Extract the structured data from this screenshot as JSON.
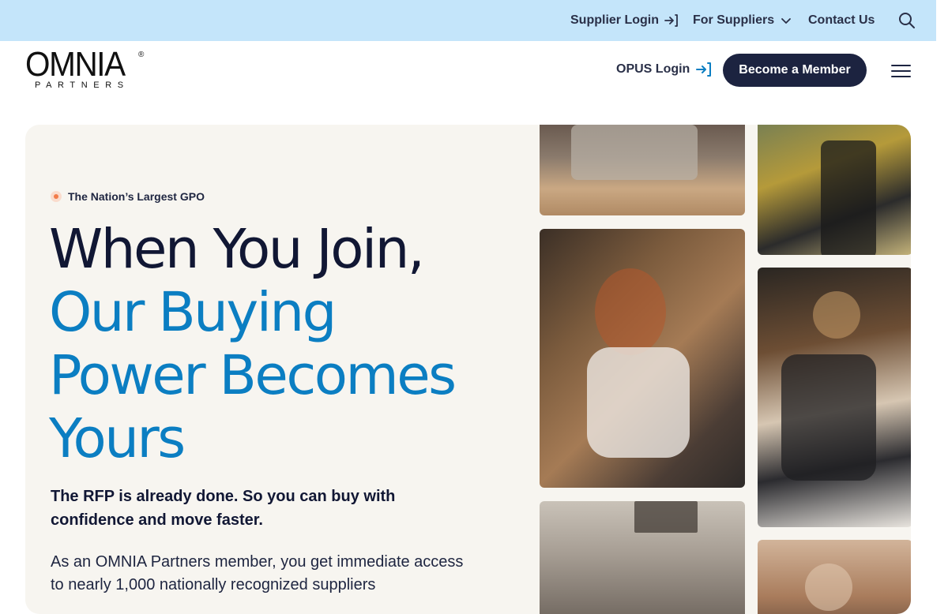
{
  "topbar": {
    "supplier_login": "Supplier Login",
    "for_suppliers": "For Suppliers",
    "contact_us": "Contact Us"
  },
  "header": {
    "logo_word": "OMNIA",
    "logo_registered": "®",
    "logo_sub": "PARTNERS",
    "opus_login": "OPUS Login",
    "become_member": "Become a Member"
  },
  "hero": {
    "eyebrow": "The Nation’s Largest GPO",
    "headline_line1": "When You Join,",
    "headline_line2": "Our Buying",
    "headline_line3": "Power Becomes",
    "headline_line4": "Yours",
    "subhead": "The RFP is already done. So you can buy with confidence and move faster.",
    "body": "As an OMNIA Partners member, you get immediate access to nearly 1,000 nationally recognized suppliers"
  },
  "icons": {
    "login": "login-arrow-icon",
    "chevron": "chevron-down-icon",
    "search": "search-icon",
    "menu": "hamburger-menu-icon"
  },
  "colors": {
    "topbar_bg": "#c4e5fa",
    "navy": "#1c2340",
    "accent_blue": "#0b7ec2",
    "dot_orange": "#f27c4a",
    "hero_bg": "#f7f5f0"
  }
}
